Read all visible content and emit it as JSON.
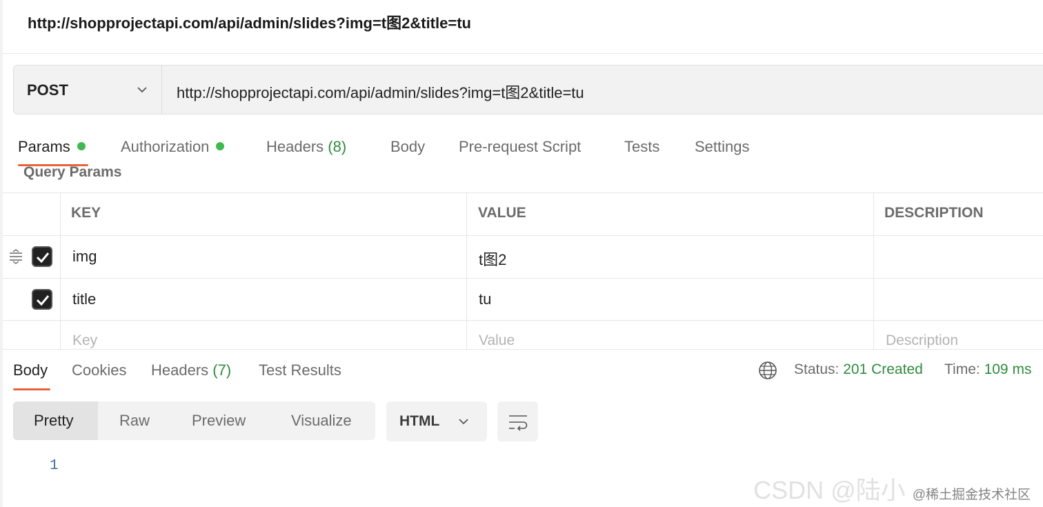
{
  "request": {
    "title": "http://shopprojectapi.com/api/admin/slides?img=t图2&title=tu",
    "method": "POST",
    "url": "http://shopprojectapi.com/api/admin/slides?img=t图2&title=tu"
  },
  "tabs": {
    "params": "Params",
    "authorization": "Authorization",
    "headers": "Headers",
    "headers_count": "(8)",
    "body": "Body",
    "prerequest": "Pre-request Script",
    "tests": "Tests",
    "settings": "Settings"
  },
  "query_params": {
    "label": "Query Params",
    "columns": [
      "KEY",
      "VALUE",
      "DESCRIPTION"
    ],
    "rows": [
      {
        "key": "img",
        "value": "t图2",
        "checked": true
      },
      {
        "key": "title",
        "value": "tu",
        "checked": true
      }
    ],
    "placeholders": {
      "key": "Key",
      "value": "Value",
      "description": "Description"
    }
  },
  "response": {
    "tabs": {
      "body": "Body",
      "cookies": "Cookies",
      "headers": "Headers",
      "headers_count": "(7)",
      "test_results": "Test Results"
    },
    "status_label": "Status:",
    "status_value": "201 Created",
    "time_label": "Time:",
    "time_value": "109 ms",
    "view_modes": [
      "Pretty",
      "Raw",
      "Preview",
      "Visualize"
    ],
    "active_view": "Pretty",
    "format": "HTML",
    "line_number": "1"
  },
  "watermark": {
    "main": "CSDN @陆小",
    "small": "@稀土掘金技术社区"
  },
  "colors": {
    "accent": "#e8623a",
    "green": "#2e8b3d",
    "dot": "#3fb950"
  },
  "icons": [
    "chevron-down-icon",
    "drag-handle-icon",
    "check-icon",
    "globe-icon",
    "wrap-lines-icon"
  ]
}
